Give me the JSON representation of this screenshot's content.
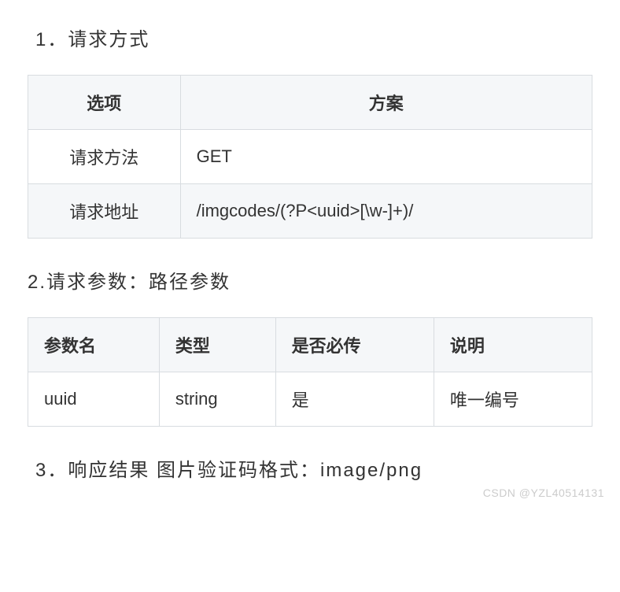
{
  "sections": {
    "s1": {
      "heading": "1．请求方式"
    },
    "s2": {
      "heading": "2.请求参数：路径参数"
    },
    "s3": {
      "heading": "3．响应结果 图片验证码格式：image/png"
    }
  },
  "table1": {
    "headers": [
      "选项",
      "方案"
    ],
    "rows": [
      {
        "c0": "请求方法",
        "c1": "GET"
      },
      {
        "c0": "请求地址",
        "c1": "/imgcodes/(?P<uuid>[\\w-]+)/"
      }
    ]
  },
  "table2": {
    "headers": [
      "参数名",
      "类型",
      "是否必传",
      "说明"
    ],
    "rows": [
      {
        "c0": "uuid",
        "c1": "string",
        "c2": "是",
        "c3": "唯一编号"
      }
    ]
  },
  "watermark": "CSDN @YZL40514131"
}
